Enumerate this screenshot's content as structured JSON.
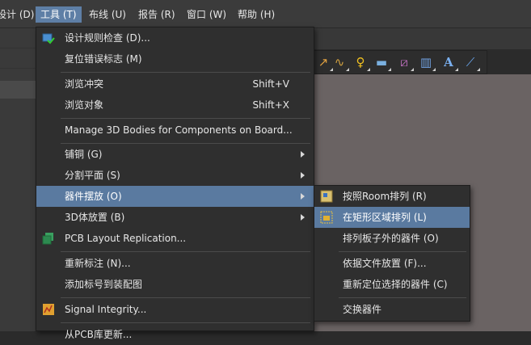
{
  "menubar": {
    "items": [
      {
        "label": "设计 (D)"
      },
      {
        "label": "工具 (T)"
      },
      {
        "label": "布线 (U)"
      },
      {
        "label": "报告 (R)"
      },
      {
        "label": "窗口 (W)"
      },
      {
        "label": "帮助 (H)"
      }
    ]
  },
  "tools_menu": {
    "items": [
      {
        "label": "设计规则检查 (D)...",
        "icon": "drc-icon"
      },
      {
        "label": "复位错误标志 (M)"
      },
      {
        "label": "浏览冲突",
        "shortcut": "Shift+V"
      },
      {
        "label": "浏览对象",
        "shortcut": "Shift+X"
      },
      {
        "label": "Manage 3D Bodies for Components on Board..."
      },
      {
        "label": "铺铜 (G)",
        "has_submenu": true
      },
      {
        "label": "分割平面 (S)",
        "has_submenu": true
      },
      {
        "label": "器件摆放 (O)",
        "has_submenu": true,
        "highlighted": true
      },
      {
        "label": "3D体放置 (B)",
        "has_submenu": true
      },
      {
        "label": "PCB Layout Replication...",
        "icon": "pcb-replication-icon"
      },
      {
        "label": "重新标注 (N)..."
      },
      {
        "label": "添加标号到装配图"
      },
      {
        "label": "Signal Integrity...",
        "icon": "signal-integrity-icon"
      },
      {
        "label": "从PCB库更新..."
      }
    ]
  },
  "placement_submenu": {
    "items": [
      {
        "label": "按照Room排列 (R)",
        "icon": "arrange-in-room-icon"
      },
      {
        "label": "在矩形区域排列 (L)",
        "icon": "arrange-in-rectangle-icon",
        "highlighted": true
      },
      {
        "label": "排列板子外的器件 (O)"
      },
      {
        "label": "依据文件放置 (F)..."
      },
      {
        "label": "重新定位选择的器件 (C)"
      },
      {
        "label": "交换器件"
      }
    ]
  },
  "toolbar": {
    "icons": [
      "route-icon",
      "wave-icon",
      "key-icon",
      "layer-icon",
      "box-icon",
      "chart-icon",
      "text-icon",
      "line-icon"
    ],
    "text_tool_glyph": "A"
  },
  "colors": {
    "menubar_bg": "#3b3b3b",
    "menu_bg": "#2f2f2f",
    "highlight": "#5a7aa0",
    "canvas": "#6a6363"
  }
}
